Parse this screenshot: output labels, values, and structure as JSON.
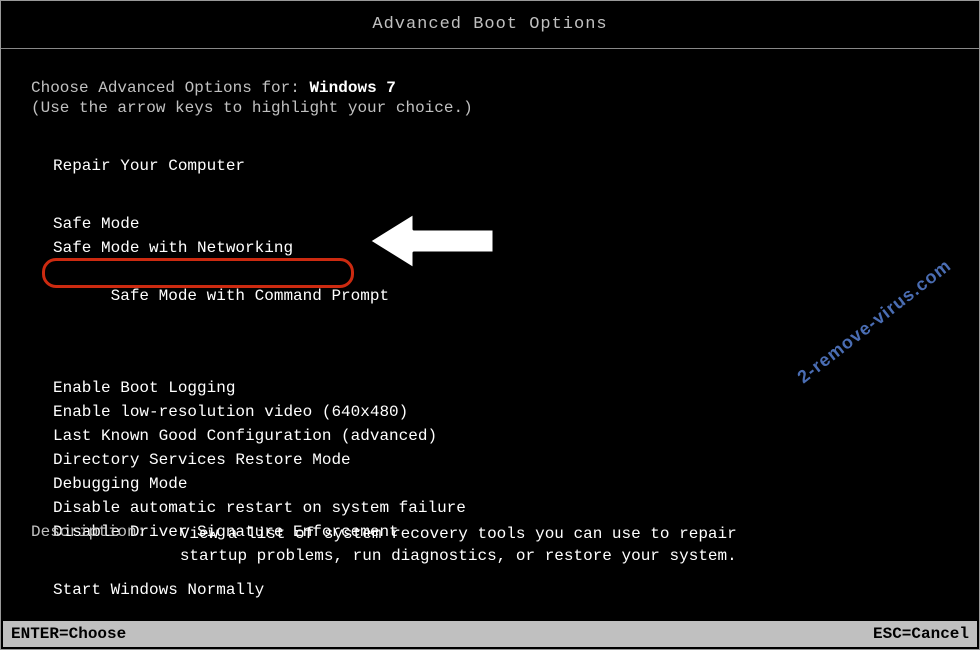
{
  "title": "Advanced Boot Options",
  "choose_prefix": "Choose Advanced Options for: ",
  "os_name": "Windows 7",
  "instruction": "(Use the arrow keys to highlight your choice.)",
  "menu": {
    "group1": [
      "Repair Your Computer"
    ],
    "group2": [
      "Safe Mode",
      "Safe Mode with Networking",
      "Safe Mode with Command Prompt"
    ],
    "group3": [
      "Enable Boot Logging",
      "Enable low-resolution video (640x480)",
      "Last Known Good Configuration (advanced)",
      "Directory Services Restore Mode",
      "Debugging Mode",
      "Disable automatic restart on system failure",
      "Disable Driver Signature Enforcement"
    ],
    "group4": [
      "Start Windows Normally"
    ]
  },
  "highlighted_item_index": 2,
  "description": {
    "label": "Description:",
    "text": "View a list of system recovery tools you can use to repair\nstartup problems, run diagnostics, or restore your system."
  },
  "footer": {
    "left": "ENTER=Choose",
    "right": "ESC=Cancel"
  },
  "watermark": "2-remove-virus.com"
}
